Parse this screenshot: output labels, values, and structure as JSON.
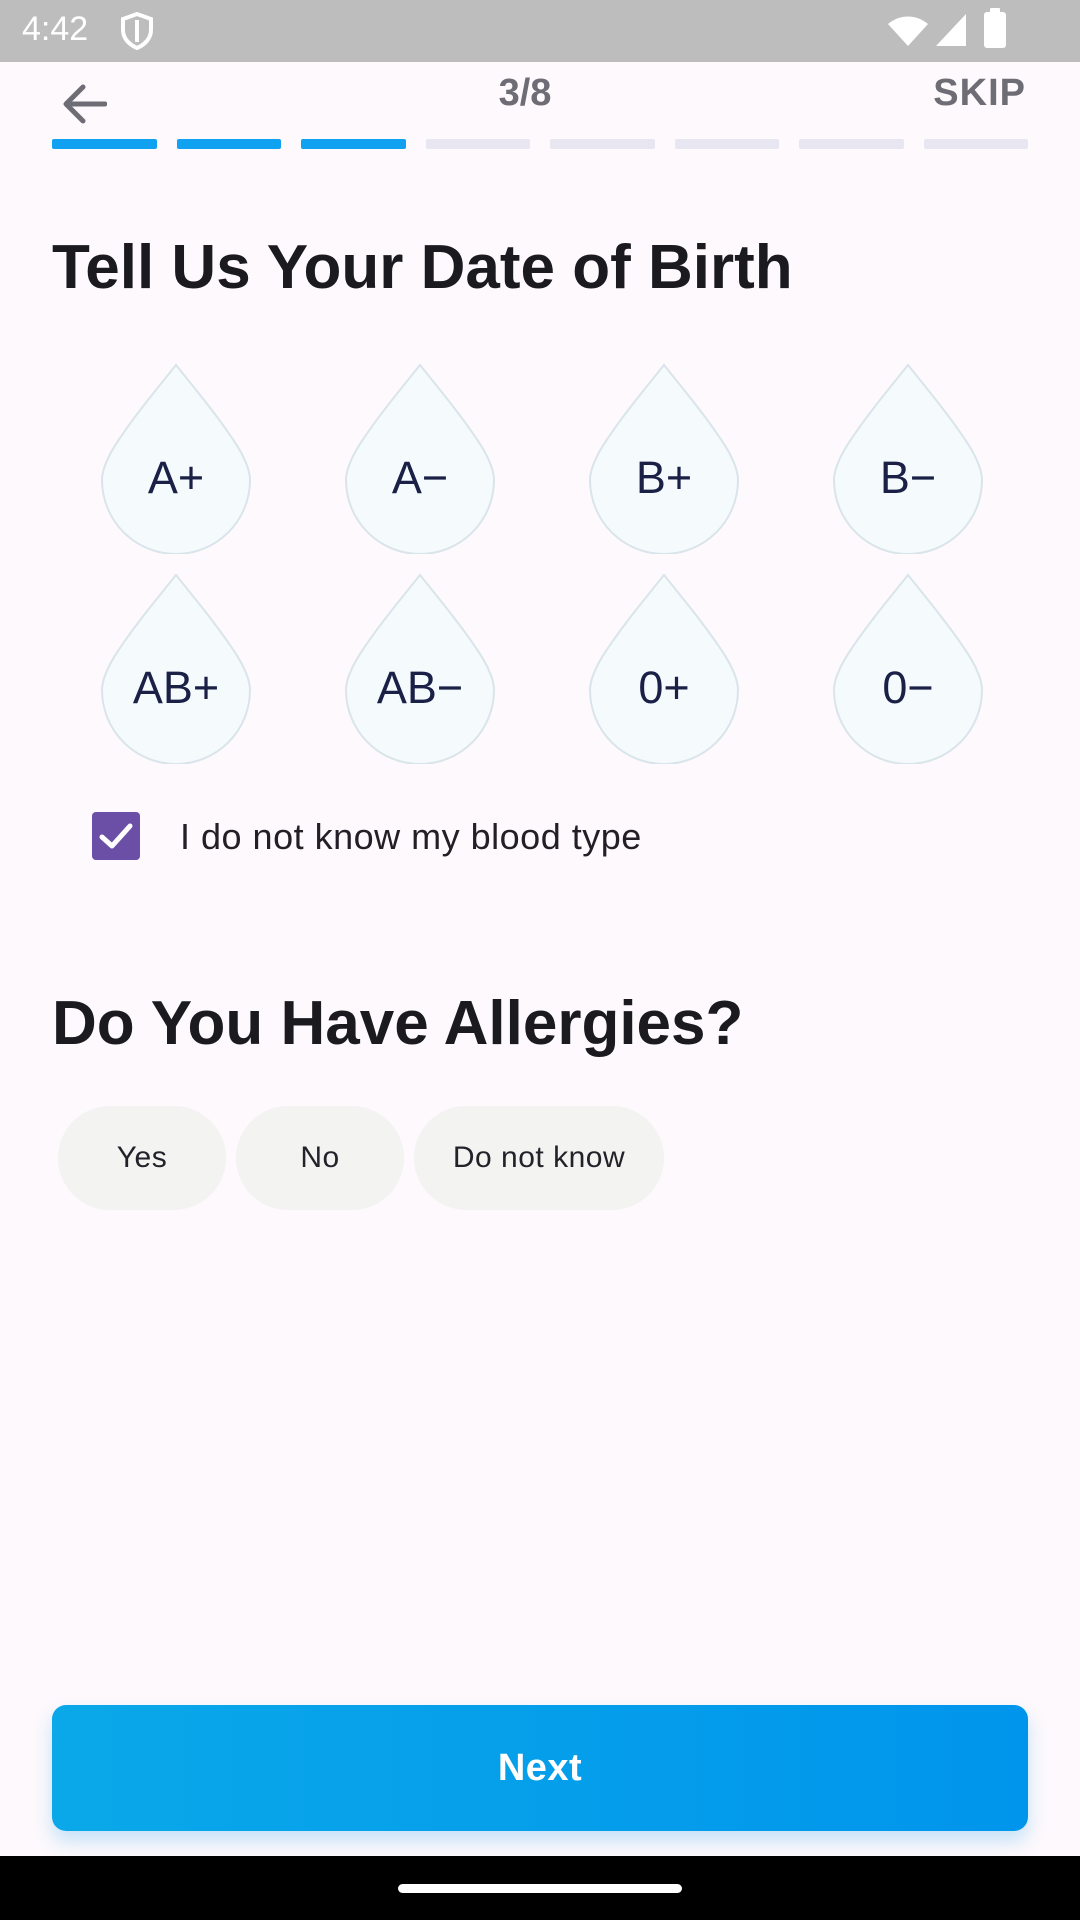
{
  "status_bar": {
    "time": "4:42"
  },
  "header": {
    "step": "3/8",
    "skip": "SKIP"
  },
  "progress": {
    "current": 3,
    "total": 8
  },
  "section_dob": {
    "title": "Tell Us Your Date of Birth"
  },
  "blood_types": [
    "A+",
    "A−",
    "B+",
    "B−",
    "AB+",
    "AB−",
    "0+",
    "0−"
  ],
  "unknown_blood": {
    "label": "I do not know my blood type",
    "checked": true
  },
  "section_allergies": {
    "title": "Do You Have Allergies?",
    "options": [
      "Yes",
      "No",
      "Do not know"
    ]
  },
  "next_button": {
    "label": "Next"
  },
  "colors": {
    "accent": "#10a2f0",
    "checkbox": "#6b4fa7",
    "drop_fill": "#f5fbfd",
    "drop_stroke": "#d9e5ea"
  }
}
